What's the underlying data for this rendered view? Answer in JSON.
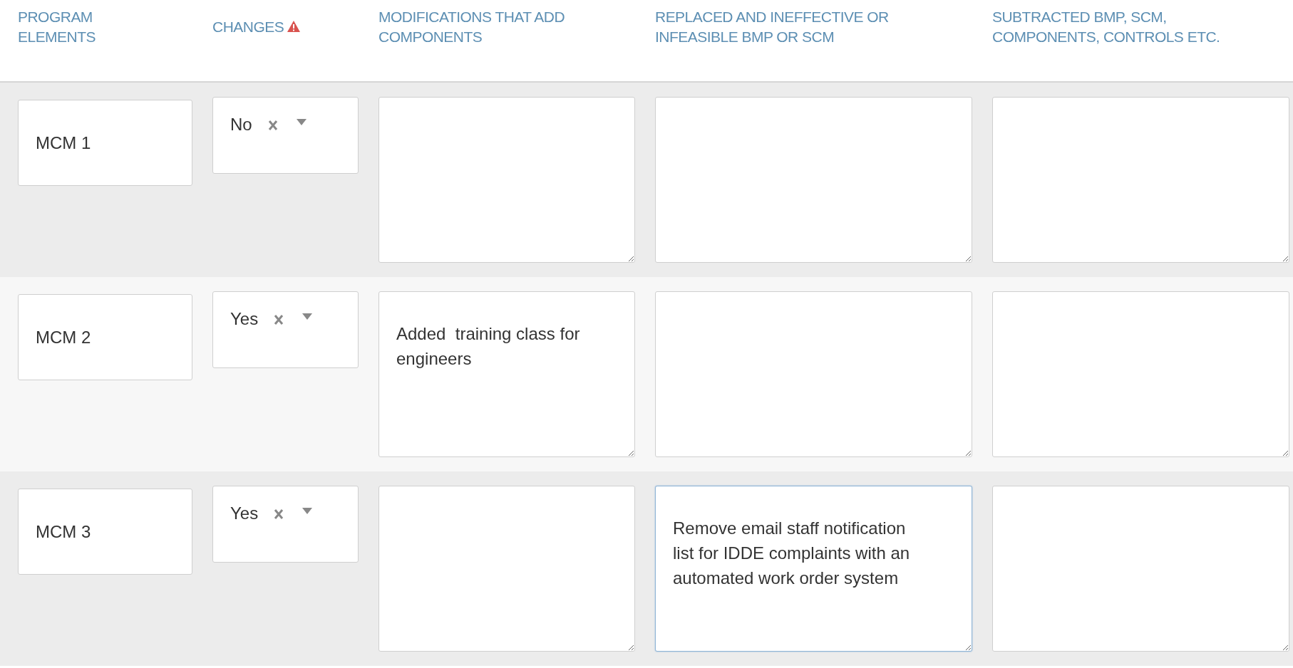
{
  "columns": [
    {
      "label": "PROGRAM ELEMENTS",
      "warning": false
    },
    {
      "label": "CHANGES",
      "warning": true
    },
    {
      "label": "MODIFICATIONS THAT ADD COMPONENTS",
      "warning": false
    },
    {
      "label": "REPLACED AND INEFFECTIVE OR INFEASIBLE BMP OR SCM",
      "warning": false
    },
    {
      "label": "SUBTRACTED BMP, SCM, COMPONENTS, CONTROLS ETC.",
      "warning": false
    }
  ],
  "rows": [
    {
      "element": "MCM 1",
      "changes": "No",
      "fields": [
        {
          "focused": false
        },
        {
          "focused": false
        },
        {
          "focused": false
        }
      ]
    },
    {
      "element": "MCM 2",
      "changes": "Yes",
      "fields": [
        {
          "value": "Added  training class for engineers",
          "focused": false
        },
        {
          "focused": false
        },
        {
          "focused": false
        }
      ]
    },
    {
      "element": "MCM 3",
      "changes": "Yes",
      "fields": [
        {
          "focused": false
        },
        {
          "value": "Remove email staff notification list for IDDE complaints with an automated work order system",
          "focused": true
        },
        {
          "focused": false
        }
      ]
    }
  ]
}
